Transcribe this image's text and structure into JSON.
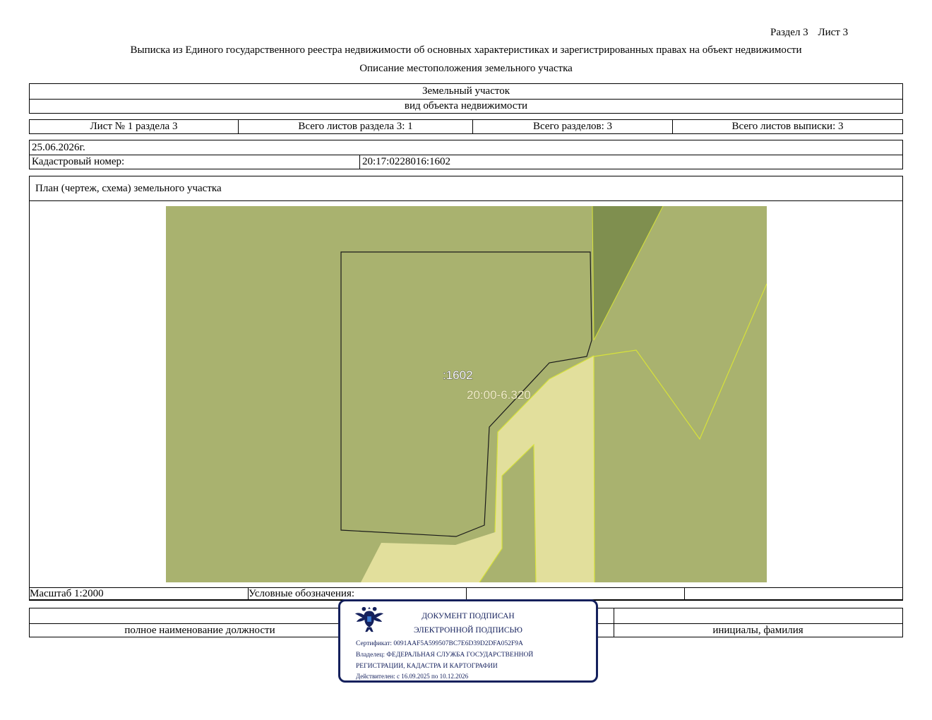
{
  "header": {
    "section": "Раздел 3",
    "sheet": "Лист 3",
    "title": "Выписка из Единого государственного реестра недвижимости об основных характеристиках и зарегистрированных правах на объект недвижимости",
    "subtitle": "Описание местоположения земельного участка"
  },
  "object": {
    "name": "Земельный участок",
    "caption": "вид объекта недвижимости"
  },
  "sheets": {
    "sheet_no": "Лист № 1 раздела 3",
    "section_total": "Всего листов раздела 3: 1",
    "sections_total": "Всего разделов: 3",
    "extract_total": "Всего листов выписки: 3"
  },
  "date": "25.06.2026г.",
  "cadastral": {
    "label": "Кадастровый номер:",
    "value": "20:17:0228016:1602"
  },
  "plan": {
    "title": "План (чертеж, схема) земельного участка",
    "parcel_label": ":1602",
    "zone_label": "20:00-6.320",
    "colors": {
      "background": "#a9b26f",
      "dark": "#7f8f4f",
      "light": "#e2df9c",
      "outline": "#d7e23a",
      "parcel": "#1a1a1a"
    }
  },
  "legend": {
    "scale": "Масштаб 1:2000",
    "symbols": "Условные обозначения:"
  },
  "signature": {
    "position_caption": "полное наименование должности",
    "name_caption": "инициалы, фамилия"
  },
  "stamp": {
    "line1": "ДОКУМЕНТ ПОДПИСАН",
    "line2": "ЭЛЕКТРОННОЙ ПОДПИСЬЮ",
    "certificate": "Сертификат: 0091AAF5A599507BC7E6D39D2DFA052F9A",
    "owner1": "Владелец: ФЕДЕРАЛЬНАЯ СЛУЖБА ГОСУДАРСТВЕННОЙ",
    "owner2": "РЕГИСТРАЦИИ, КАДАСТРА И КАРТОГРАФИИ",
    "valid": "Действителен: с 16.09.2025 по 10.12.2026",
    "emblem_icon": "double-headed-eagle-icon",
    "color": "#14205c"
  }
}
